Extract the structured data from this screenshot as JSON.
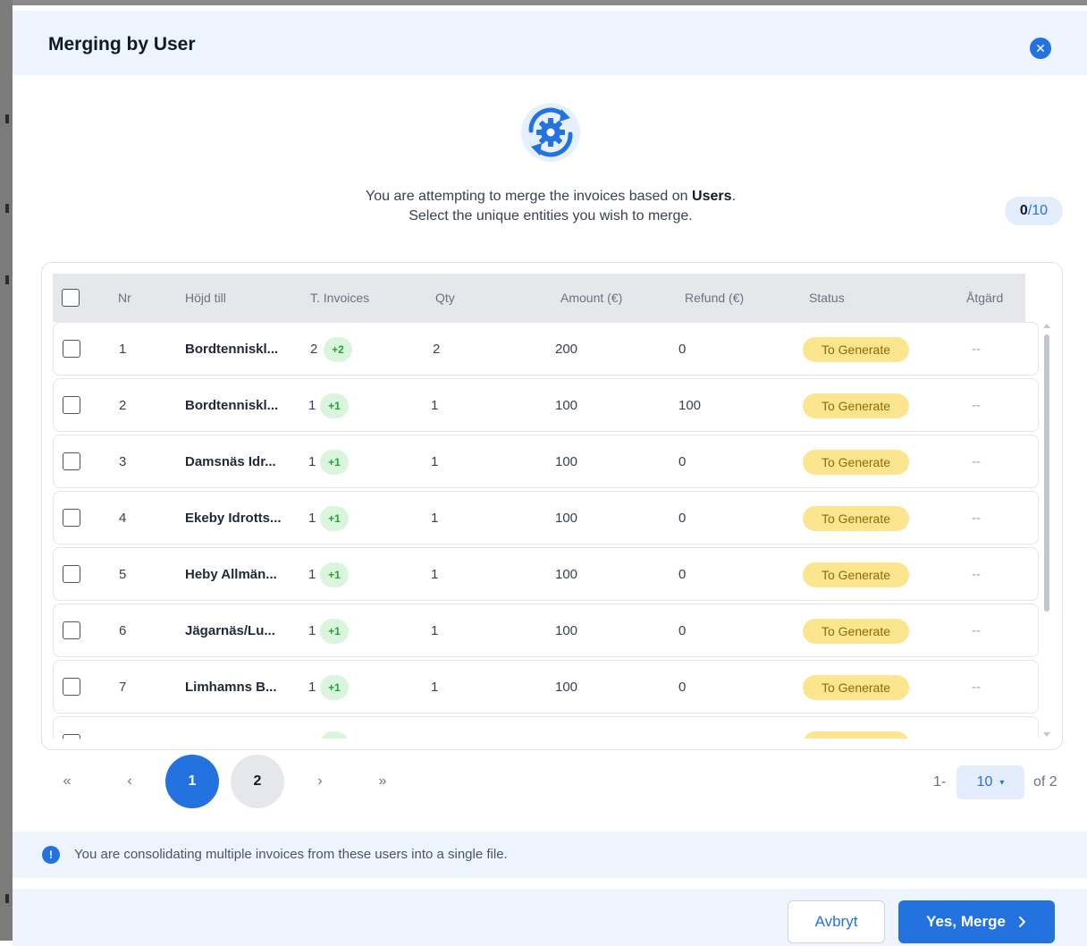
{
  "dialog": {
    "title": "Merging by User",
    "close_icon": "close-icon"
  },
  "intro": {
    "line1_before": "You are attempting to merge the invoices based on ",
    "line1_bold": "Users",
    "line1_after": ".",
    "line2": "Select the unique entities you wish to merge."
  },
  "selection": {
    "selected": "0",
    "total": "/10"
  },
  "table": {
    "columns": [
      "Nr",
      "Höjd till",
      "T. Invoices",
      "Qty",
      "Amount (€)",
      "Refund (€)",
      "Status",
      "Åtgärd"
    ],
    "rows": [
      {
        "nr": "1",
        "name": "Bordtenniskl...",
        "invoices": "2",
        "badge": "+2",
        "qty": "2",
        "amount": "200",
        "refund": "0",
        "status": "To Generate",
        "action": "--"
      },
      {
        "nr": "2",
        "name": "Bordtenniskl...",
        "invoices": "1",
        "badge": "+1",
        "qty": "1",
        "amount": "100",
        "refund": "100",
        "status": "To Generate",
        "action": "--"
      },
      {
        "nr": "3",
        "name": "Damsnäs Idr...",
        "invoices": "1",
        "badge": "+1",
        "qty": "1",
        "amount": "100",
        "refund": "0",
        "status": "To Generate",
        "action": "--"
      },
      {
        "nr": "4",
        "name": "Ekeby Idrotts...",
        "invoices": "1",
        "badge": "+1",
        "qty": "1",
        "amount": "100",
        "refund": "0",
        "status": "To Generate",
        "action": "--"
      },
      {
        "nr": "5",
        "name": "Heby Allmän...",
        "invoices": "1",
        "badge": "+1",
        "qty": "1",
        "amount": "100",
        "refund": "0",
        "status": "To Generate",
        "action": "--"
      },
      {
        "nr": "6",
        "name": "Jägarnäs/Lu...",
        "invoices": "1",
        "badge": "+1",
        "qty": "1",
        "amount": "100",
        "refund": "0",
        "status": "To Generate",
        "action": "--"
      },
      {
        "nr": "7",
        "name": "Limhamns B...",
        "invoices": "1",
        "badge": "+1",
        "qty": "1",
        "amount": "100",
        "refund": "0",
        "status": "To Generate",
        "action": "--"
      }
    ]
  },
  "pagination": {
    "first": "«",
    "prev": "‹",
    "pages": [
      "1",
      "2"
    ],
    "current": "1",
    "next": "›",
    "last": "»",
    "range_prefix": "1-",
    "per_page": "10",
    "per_page_caret": "▾",
    "range_suffix": "of 2"
  },
  "info": {
    "icon": "info-icon",
    "text": "You are consolidating multiple invoices from these users into a single file."
  },
  "footer": {
    "cancel_label": "Avbryt",
    "merge_label": "Yes, Merge",
    "merge_icon": "chevron-right-icon"
  },
  "colors": {
    "accent": "#2472e0",
    "header_bg": "#eef4fd",
    "status_bg": "#fce58f",
    "badge_bg": "#d9f5dc"
  }
}
